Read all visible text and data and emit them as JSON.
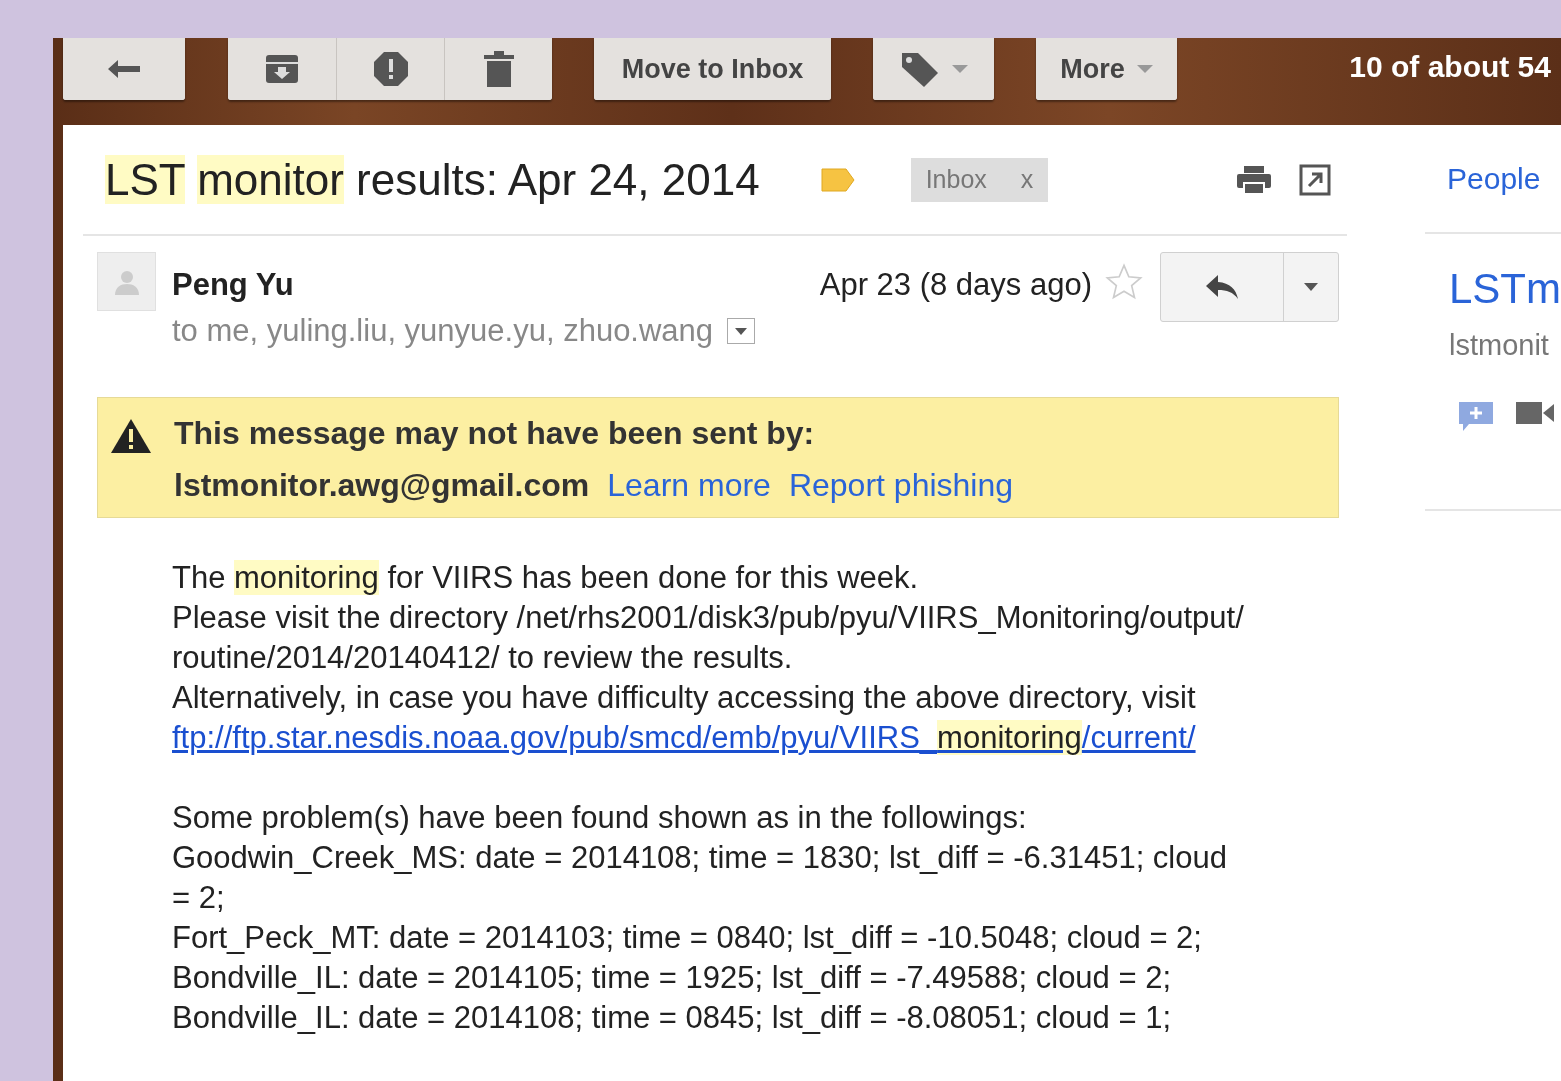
{
  "toolbar": {
    "groups": [
      {
        "buttons": [
          {
            "kind": "back"
          }
        ]
      },
      {
        "buttons": [
          {
            "kind": "archive"
          },
          {
            "kind": "spam"
          },
          {
            "kind": "delete"
          }
        ]
      },
      {
        "buttons": [
          {
            "kind": "text",
            "label": "Move to Inbox"
          }
        ]
      },
      {
        "buttons": [
          {
            "kind": "labels"
          }
        ]
      },
      {
        "buttons": [
          {
            "kind": "menu",
            "label": "More"
          }
        ]
      }
    ],
    "pager": "10 of about 54"
  },
  "subject": {
    "segments": [
      {
        "text": "LST",
        "highlight": true
      },
      {
        "text": "monitor",
        "highlight": true
      },
      {
        "text": " results: Apr 24, 2014",
        "highlight": false
      }
    ],
    "label_chip": {
      "label": "Inbox",
      "remove": "x"
    }
  },
  "message": {
    "sender": "Peng Yu",
    "date": "Apr 23 (8 days ago)",
    "starred": false,
    "recipients": "to me, yuling.liu, yunyue.yu, zhuo.wang"
  },
  "warning": {
    "heading": "This message may not have been sent by:",
    "address": "lstmonitor.awg@gmail.com",
    "links": [
      "Learn more",
      "Report phishing"
    ]
  },
  "body": [
    {
      "kind": "text",
      "segments": [
        {
          "text": "The ",
          "highlight": false
        },
        {
          "text": "monitoring",
          "highlight": true
        },
        {
          "text": " for VIIRS has been done for this week.",
          "highlight": false
        }
      ]
    },
    {
      "kind": "text",
      "segments": [
        {
          "text": "Please visit the directory /net/rhs2001/disk3/pub/pyu/VIIRS_Monitoring/output/",
          "highlight": false
        }
      ]
    },
    {
      "kind": "text",
      "segments": [
        {
          "text": "routine/2014/20140412/ to review the results.",
          "highlight": false
        }
      ]
    },
    {
      "kind": "text",
      "segments": [
        {
          "text": "Alternatively, in case you have difficulty accessing the above directory, visit",
          "highlight": false
        }
      ]
    },
    {
      "kind": "link",
      "segments": [
        {
          "text": "ftp://ftp.star.nesdis.noaa.gov/pub/smcd/emb/pyu/VIIRS_",
          "highlight": false
        },
        {
          "text": "monitoring",
          "highlight": true
        },
        {
          "text": "/current/",
          "highlight": false
        }
      ]
    },
    {
      "kind": "blank"
    },
    {
      "kind": "text",
      "segments": [
        {
          "text": "Some problem(s) have been found shown as in the followings:",
          "highlight": false
        }
      ]
    },
    {
      "kind": "text",
      "segments": [
        {
          "text": "Goodwin_Creek_MS: date = 2014108; time = 1830; lst_diff = -6.31451; cloud",
          "highlight": false
        }
      ]
    },
    {
      "kind": "text",
      "segments": [
        {
          "text": "= 2;",
          "highlight": false
        }
      ]
    },
    {
      "kind": "text",
      "segments": [
        {
          "text": "Fort_Peck_MT: date = 2014103; time = 0840; lst_diff = -10.5048; cloud = 2;",
          "highlight": false
        }
      ]
    },
    {
      "kind": "text",
      "segments": [
        {
          "text": "Bondville_IL: date = 2014105; time = 1925; lst_diff = -7.49588; cloud = 2;",
          "highlight": false
        }
      ]
    },
    {
      "kind": "text",
      "segments": [
        {
          "text": "Bondville_IL: date = 2014108; time = 0845; lst_diff = -8.08051; cloud = 1;",
          "highlight": false
        }
      ]
    }
  ],
  "side": {
    "heading": "People",
    "contact_name": "LSTm",
    "contact_email": "lstmonit"
  }
}
